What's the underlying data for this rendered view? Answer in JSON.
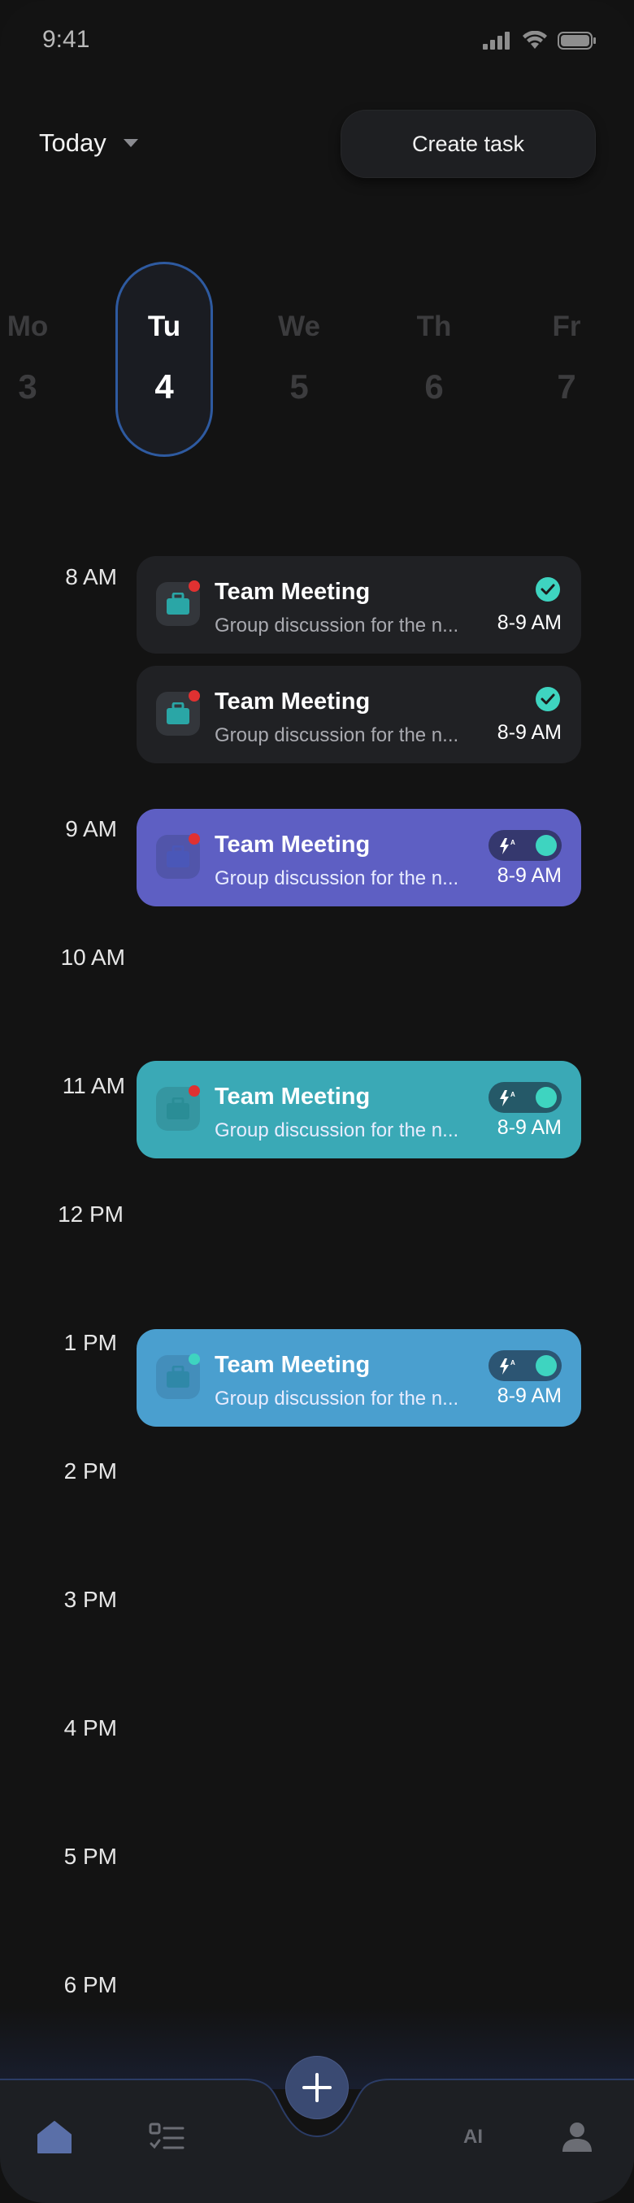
{
  "status_bar": {
    "time": "9:41"
  },
  "header": {
    "today_label": "Today",
    "create_task_label": "Create task"
  },
  "days": [
    {
      "name": "Mo",
      "date": "3"
    },
    {
      "name": "Tu",
      "date": "4"
    },
    {
      "name": "We",
      "date": "5"
    },
    {
      "name": "Th",
      "date": "6"
    },
    {
      "name": "Fr",
      "date": "7"
    }
  ],
  "selected_day": "Tu",
  "hours": [
    "8 AM",
    "9 AM",
    "10 AM",
    "11 AM",
    "12 PM",
    "1 PM",
    "2 PM",
    "3 PM",
    "4 PM",
    "5 PM",
    "6 PM"
  ],
  "tasks": [
    {
      "title": "Team Meeting",
      "description": "Group discussion for the n...",
      "time": "8-9 AM",
      "status": "done",
      "color": "#202124",
      "hour": "8 AM"
    },
    {
      "title": "Team Meeting",
      "description": "Group discussion for the n...",
      "time": "8-9 AM",
      "status": "done",
      "color": "#202124",
      "hour": "8 AM"
    },
    {
      "title": "Team Meeting",
      "description": "Group discussion for the n...",
      "time": "8-9 AM",
      "status": "auto-toggle-on",
      "color": "#5e5fc3",
      "hour": "9 AM"
    },
    {
      "title": "Team Meeting",
      "description": "Group discussion for the n...",
      "time": "8-9 AM",
      "status": "auto-toggle-on",
      "color": "#3aa9b6",
      "hour": "11 AM"
    },
    {
      "title": "Team Meeting",
      "description": "Group discussion for the n...",
      "time": "8-9 AM",
      "status": "auto-toggle-on",
      "color": "#4a9fcf",
      "hour": "1 PM"
    }
  ],
  "nav": {
    "items": [
      "home-icon",
      "tasks-icon",
      "add-icon",
      "ai-icon",
      "profile-icon"
    ],
    "ai_label": "AI",
    "active": "home-icon"
  },
  "colors": {
    "accent": "#3ed4c0",
    "alert_dot": "#e03131",
    "selected_day_border": "#2e5aa0",
    "nav_active": "#5a6fa8"
  }
}
